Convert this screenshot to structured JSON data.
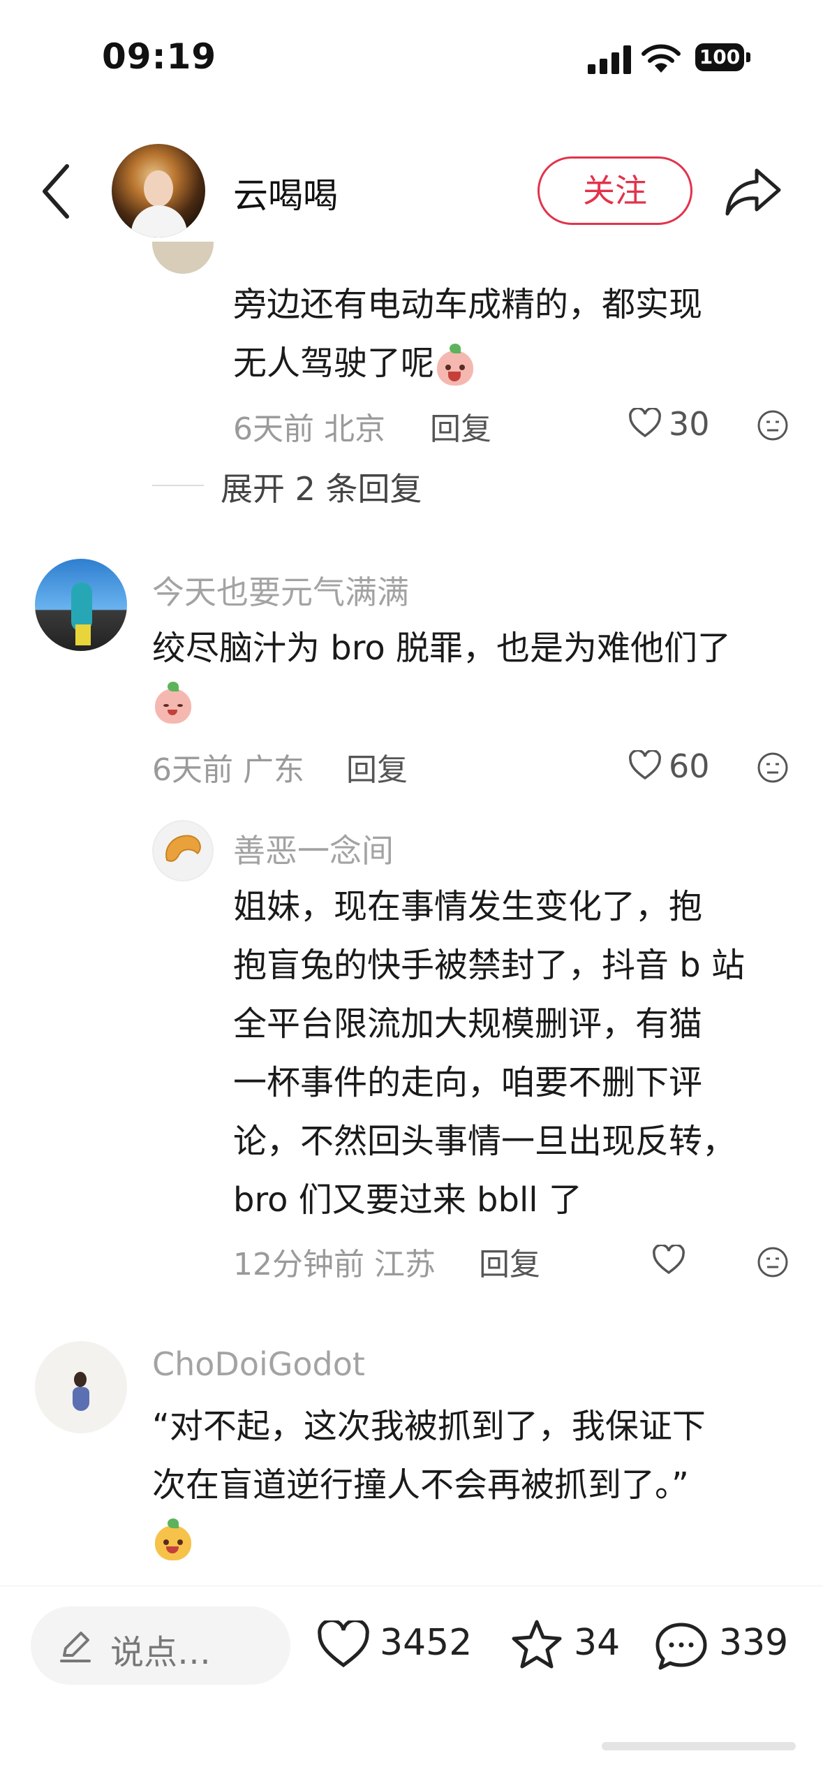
{
  "status_bar": {
    "time": "09:19",
    "battery": "100"
  },
  "header": {
    "username": "云喝喝",
    "follow_label": "关注"
  },
  "thread": {
    "reply_text_line1": "旁边还有电动车成精的，都实现",
    "reply_text_line2": "无人驾驶了呢",
    "reply_meta": "6天前 北京",
    "reply_label": "回复",
    "reply_likes": "30",
    "expand_label": "展开 2 条回复"
  },
  "comments": [
    {
      "username": "今天也要元气满满",
      "text": "绞尽脑汁为 bro 脱罪，也是为难他们了",
      "meta": "6天前 广东",
      "reply_label": "回复",
      "likes": "60",
      "sub_reply": {
        "username": "善恶一念间",
        "lines": [
          "姐妹，现在事情发生变化了，抱",
          "抱盲兔的快手被禁封了，抖音 b 站",
          "全平台限流加大规模删评，有猫",
          "一杯事件的走向，咱要不删下评",
          "论，不然回头事情一旦出现反转，",
          "bro 们又要过来 bbll 了"
        ],
        "meta": "12分钟前 江苏",
        "reply_label": "回复"
      }
    },
    {
      "username": "ChoDoiGodot",
      "lines": [
        "“对不起，这次我被抓到了，我保证下",
        "次在盲道逆行撞人不会再被抓到了。”"
      ]
    }
  ],
  "bottom_bar": {
    "input_placeholder": "说点…",
    "like_count": "3452",
    "fav_count": "34",
    "comment_count": "339"
  }
}
